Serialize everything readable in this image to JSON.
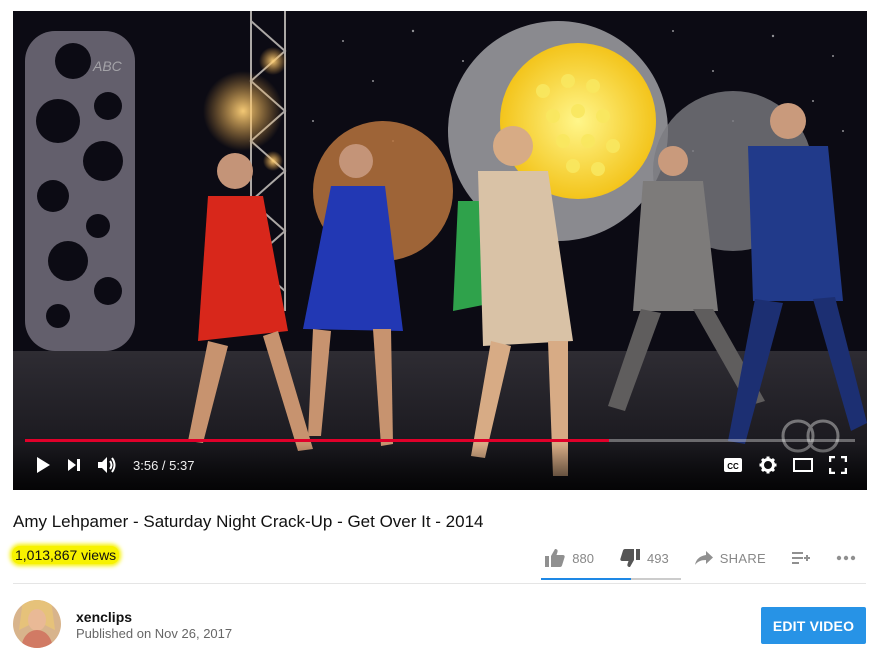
{
  "player": {
    "current_time": "3:56",
    "separator": " / ",
    "duration": "5:37",
    "progress_fraction": 0.704,
    "watermark_text": "ABC",
    "icons": [
      "play-icon",
      "next-icon",
      "volume-icon",
      "captions-icon",
      "settings-icon",
      "theater-icon",
      "fullscreen-icon"
    ],
    "captions_label": "CC"
  },
  "video": {
    "title": "Amy Lehpamer - Saturday Night Crack-Up - Get Over It - 2014",
    "views": "1,013,867 views"
  },
  "actions": {
    "likes": "880",
    "dislikes": "493",
    "share_label": "SHARE",
    "like_fraction": 0.641,
    "icons": [
      "thumbs-up-icon",
      "thumbs-down-icon",
      "share-icon",
      "add-to-playlist-icon",
      "more-icon"
    ]
  },
  "channel": {
    "name": "xenclips",
    "published": "Published on Nov 26, 2017",
    "edit_button_label": "EDIT VIDEO"
  },
  "colors": {
    "progress": "#e1002a",
    "like_bar": "#1e88e5",
    "edit_button": "#2793e6",
    "highlight": "#f7f200"
  }
}
